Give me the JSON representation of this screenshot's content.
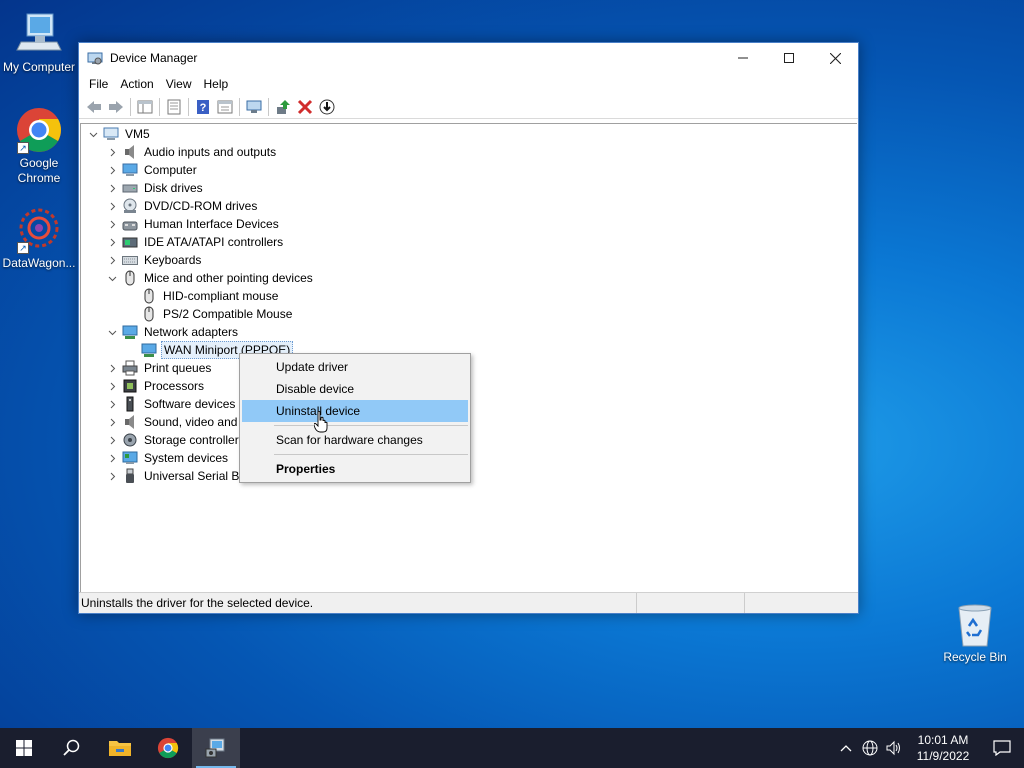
{
  "desktop": {
    "icons": [
      {
        "label": "My Computer"
      },
      {
        "label": "Google Chrome"
      },
      {
        "label": "DataWagon..."
      },
      {
        "label": "Recycle Bin"
      }
    ]
  },
  "window": {
    "title": "Device Manager",
    "controls": {
      "minimize": "—",
      "maximize": "☐",
      "close": "✕"
    },
    "menu": [
      "File",
      "Action",
      "View",
      "Help"
    ],
    "toolbar_icons": [
      "back-icon",
      "forward-icon",
      "show-hide-console-tree-icon",
      "properties-icon",
      "help-icon",
      "view-icon",
      "monitor-icon",
      "update-driver-icon",
      "uninstall-icon",
      "download-icon"
    ]
  },
  "tree": {
    "root": "VM5",
    "nodes": [
      {
        "label": "Audio inputs and outputs",
        "expanded": false,
        "icon": "speaker-icon"
      },
      {
        "label": "Computer",
        "expanded": false,
        "icon": "computer-icon"
      },
      {
        "label": "Disk drives",
        "expanded": false,
        "icon": "disk-drive-icon"
      },
      {
        "label": "DVD/CD-ROM drives",
        "expanded": false,
        "icon": "dvd-icon"
      },
      {
        "label": "Human Interface Devices",
        "expanded": false,
        "icon": "hid-icon"
      },
      {
        "label": "IDE ATA/ATAPI controllers",
        "expanded": false,
        "icon": "ide-controller-icon"
      },
      {
        "label": "Keyboards",
        "expanded": false,
        "icon": "keyboard-icon"
      },
      {
        "label": "Mice and other pointing devices",
        "expanded": true,
        "icon": "mouse-icon"
      },
      {
        "label": "HID-compliant mouse",
        "child": true,
        "icon": "mouse-icon"
      },
      {
        "label": "PS/2 Compatible Mouse",
        "child": true,
        "icon": "mouse-icon"
      },
      {
        "label": "Network adapters",
        "expanded": true,
        "icon": "network-adapter-icon"
      },
      {
        "label": "WAN Miniport (PPPOE)",
        "child": true,
        "selected": true,
        "icon": "network-adapter-icon"
      },
      {
        "label": "Print queues",
        "expanded": false,
        "icon": "printer-icon"
      },
      {
        "label": "Processors",
        "expanded": false,
        "icon": "processor-icon"
      },
      {
        "label": "Software devices",
        "expanded": false,
        "icon": "software-device-icon"
      },
      {
        "label": "Sound, video and game controllers",
        "expanded": false,
        "icon": "speaker-icon"
      },
      {
        "label": "Storage controllers",
        "expanded": false,
        "icon": "storage-controller-icon"
      },
      {
        "label": "System devices",
        "expanded": false,
        "icon": "system-device-icon"
      },
      {
        "label": "Universal Serial Bus controllers",
        "expanded": false,
        "icon": "usb-icon"
      }
    ]
  },
  "context_menu": {
    "items": [
      "Update driver",
      "Disable device",
      "Uninstall device",
      "Scan for hardware changes",
      "Properties"
    ],
    "highlighted": "Uninstall device"
  },
  "status": {
    "text": "Uninstalls the driver for the selected device."
  },
  "taskbar": {
    "time": "10:01 AM",
    "date": "11/9/2022",
    "tray_icons": [
      "chevron-up-icon",
      "network-globe-icon",
      "volume-icon"
    ]
  },
  "colors": {
    "accent": "#0078d7",
    "menu_highlight": "#91c9f7",
    "taskbar": "#1a1e2e"
  }
}
